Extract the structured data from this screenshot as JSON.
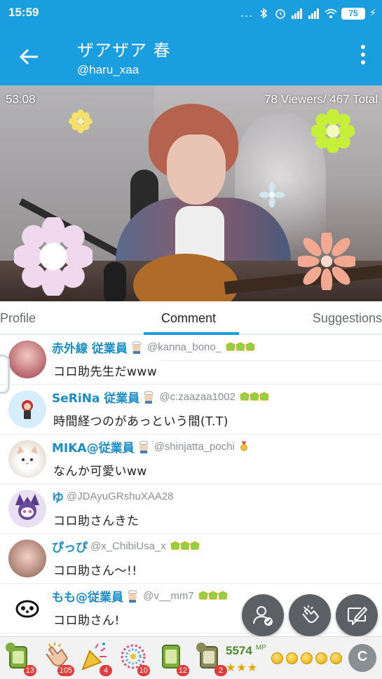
{
  "status_bar": {
    "time": "15:59",
    "dots": "...",
    "battery": "75"
  },
  "app_bar": {
    "title": "ザアザア 春",
    "subtitle": "@haru_xaa"
  },
  "video": {
    "timer": "53:08",
    "viewers": "78 Viewers/ 467 Total"
  },
  "tabs": [
    {
      "label": "Profile",
      "active": false
    },
    {
      "label": "Comment",
      "active": true
    },
    {
      "label": "Suggestions",
      "active": false
    }
  ],
  "comments": [
    {
      "name": "赤外線 従業員",
      "handle": "@kanna_bono_",
      "text": "コロ助先生だwww",
      "staff": true,
      "badge": "three-green"
    },
    {
      "name": "SeRiNa 従業員",
      "handle": "@c:zaazaa1002",
      "text": "時間経つのがあっという間(T.T)",
      "staff": true,
      "badge": "three-green"
    },
    {
      "name": "MIKA@従業員",
      "handle": "@shinjatta_pochi",
      "text": "なんか可愛いww",
      "staff": true,
      "badge": "medal"
    },
    {
      "name": "ゆ",
      "handle": "@JDAyuGRshuXAA28",
      "text": "コロ助さんきた",
      "staff": false,
      "badge": ""
    },
    {
      "name": "ぴっぴ",
      "handle": "@x_ChibiUsa_x",
      "text": "コロ助さん〜!!",
      "staff": false,
      "badge": "three-green"
    },
    {
      "name": "もも@従業員",
      "handle": "@v__mm7",
      "text": "コロ助さん!",
      "staff": true,
      "badge": "three-green"
    }
  ],
  "gift_bar": {
    "gifts": [
      {
        "icon": "tea-cup-icon",
        "count": "13",
        "tag": "10"
      },
      {
        "icon": "clap-icon",
        "count": "105",
        "tag": ""
      },
      {
        "icon": "party-popper-icon",
        "count": "4",
        "tag": ""
      },
      {
        "icon": "fireworks-icon",
        "count": "10",
        "tag": ""
      },
      {
        "icon": "tea-cup-icon",
        "count": "12",
        "tag": ""
      },
      {
        "icon": "tea-cup-icon",
        "count": "2",
        "tag": "100"
      }
    ],
    "mp_value": "5574",
    "mp_unit": "MP",
    "stars": "★★★",
    "coin_count": 5,
    "c_label": "C"
  },
  "colors": {
    "brand": "#1a9ee0",
    "name": "#1a8cc8",
    "fab": "#4f5358"
  }
}
